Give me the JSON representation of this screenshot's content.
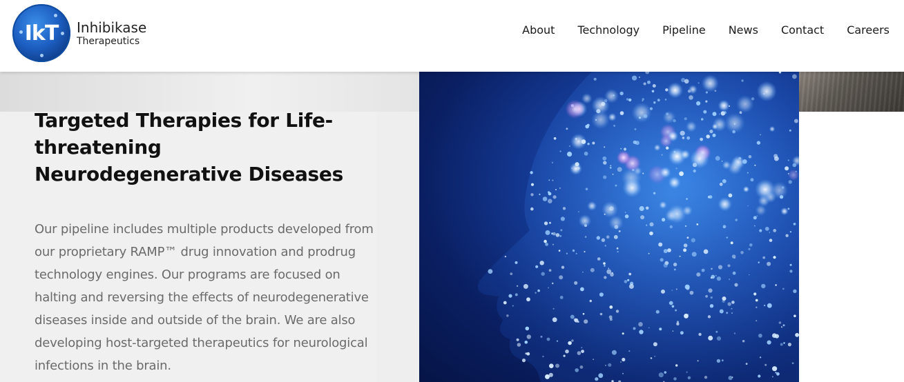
{
  "brand": {
    "mark": "IkT",
    "name": "Inhibikase",
    "sub": "Therapeutics",
    "color": "#1d5fc2"
  },
  "nav": {
    "items": [
      {
        "label": "About"
      },
      {
        "label": "Technology"
      },
      {
        "label": "Pipeline"
      },
      {
        "label": "News"
      },
      {
        "label": "Contact"
      },
      {
        "label": "Careers"
      }
    ]
  },
  "hero": {
    "title": "Targeted Therapies for Life-threatening Neurodegenerative Diseases",
    "body": "Our pipeline includes multiple products developed from our proprietary RAMP™ drug innovation and prodrug technology engines. Our programs are focused on halting and reversing the effects of neurodegenerative diseases inside and outside of the brain.  We are also developing host-targeted therapeutics for neurological infections in the brain."
  }
}
